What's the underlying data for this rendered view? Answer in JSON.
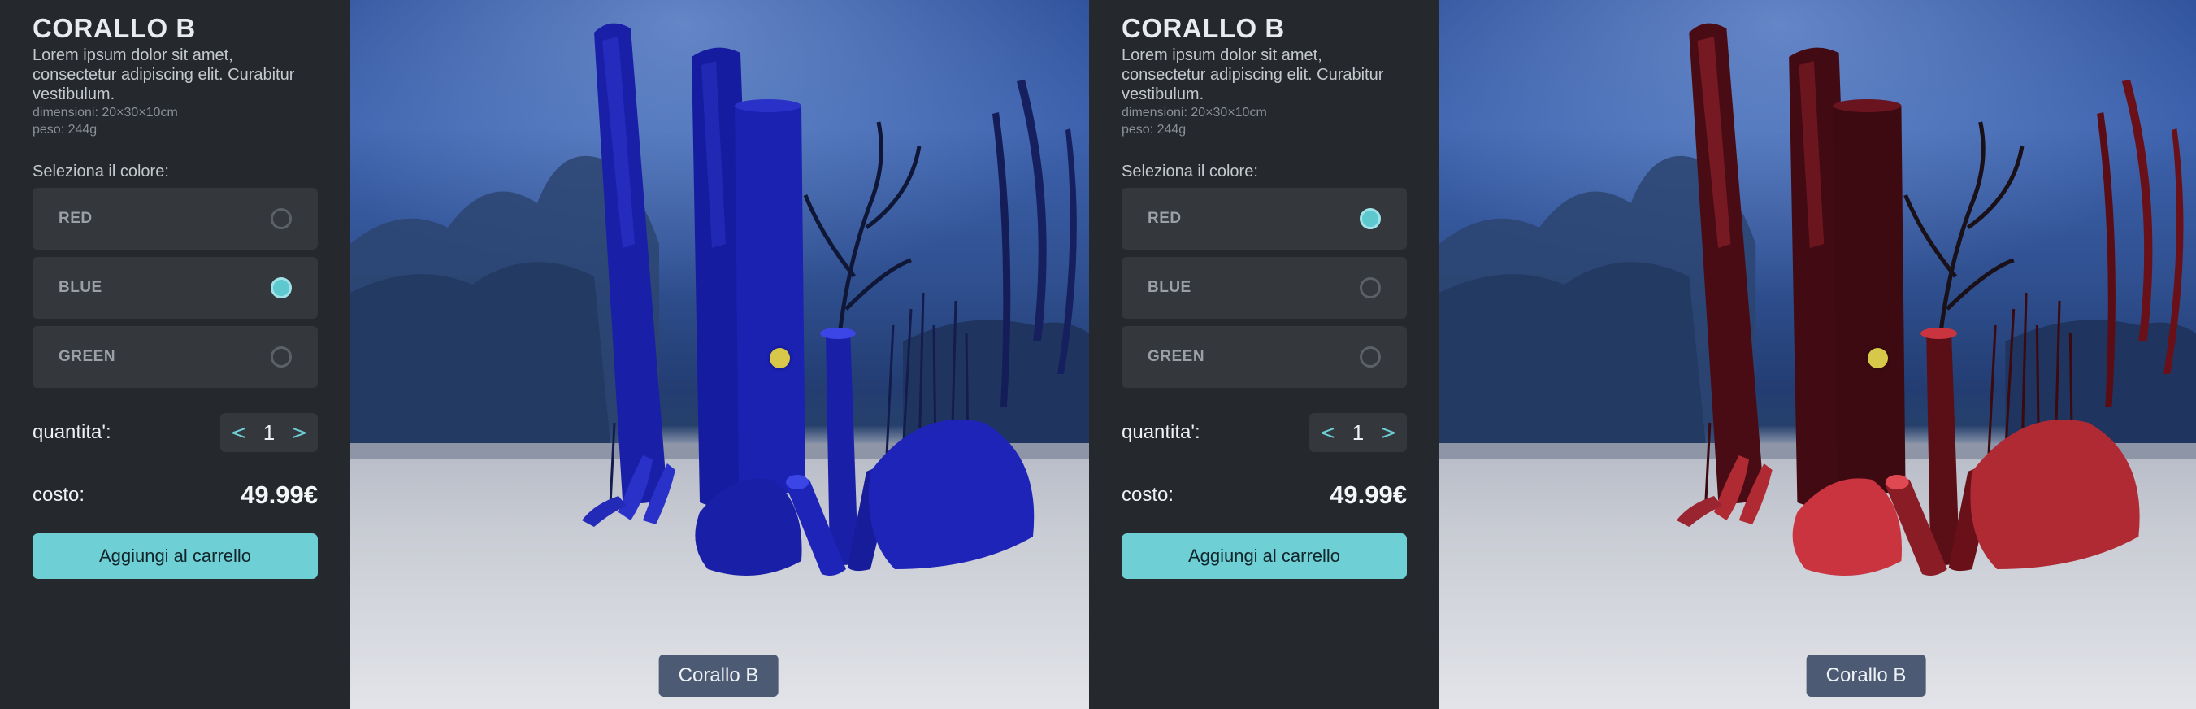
{
  "screens": [
    {
      "panel": {
        "title": "CORALLO B",
        "description": "Lorem ipsum dolor sit amet, consectetur adipiscing elit. Curabitur vestibulum.",
        "dimensions": "dimensioni: 20×30×10cm",
        "weight": "peso: 244g",
        "color_prompt": "Seleziona il colore:",
        "color_options": [
          {
            "label": "RED",
            "selected": false
          },
          {
            "label": "BLUE",
            "selected": true
          },
          {
            "label": "GREEN",
            "selected": false
          }
        ],
        "quantity_label": "quantita':",
        "quantity_decrement": "<",
        "quantity_value": "1",
        "quantity_increment": ">",
        "cost_label": "costo:",
        "price": "49.99€",
        "add_to_cart": "Aggiungi al carrello"
      },
      "viewer": {
        "model_label": "Corallo B",
        "coral_color": "#1a1fa8",
        "coral_highlight": "#3c46e6",
        "hotspot_color": "#d8c84a"
      }
    },
    {
      "panel": {
        "title": "CORALLO B",
        "description": "Lorem ipsum dolor sit amet, consectetur adipiscing elit. Curabitur vestibulum.",
        "dimensions": "dimensioni: 20×30×10cm",
        "weight": "peso: 244g",
        "color_prompt": "Seleziona il colore:",
        "color_options": [
          {
            "label": "RED",
            "selected": true
          },
          {
            "label": "BLUE",
            "selected": false
          },
          {
            "label": "GREEN",
            "selected": false
          }
        ],
        "quantity_label": "quantita':",
        "quantity_decrement": "<",
        "quantity_value": "1",
        "quantity_increment": ">",
        "cost_label": "costo:",
        "price": "49.99€",
        "add_to_cart": "Aggiungi al carrello"
      },
      "viewer": {
        "model_label": "Corallo B",
        "coral_color": "#5a0f16",
        "coral_highlight": "#c9343f",
        "hotspot_color": "#d8c84a"
      }
    }
  ]
}
